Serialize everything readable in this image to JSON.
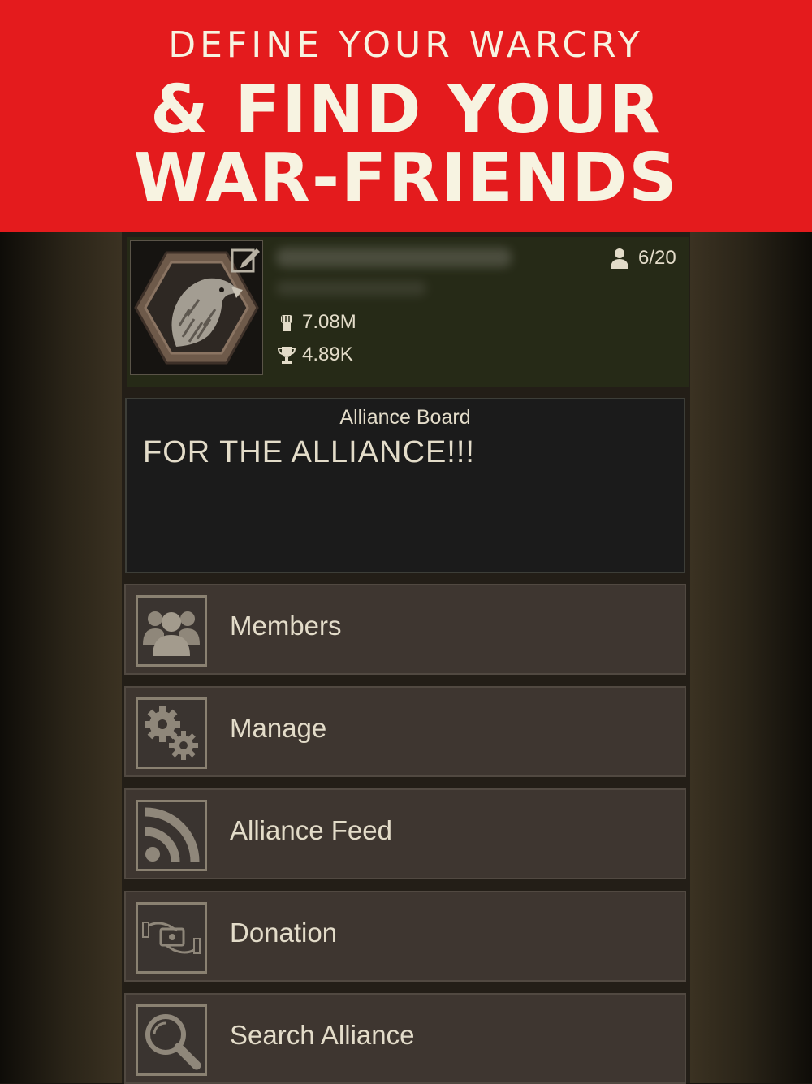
{
  "banner": {
    "line1": "DEFINE YOUR WARCRY",
    "line2": "& FIND YOUR",
    "line3": "WAR-FRIENDS"
  },
  "alliance": {
    "member_count": "6/20",
    "power": "7.08M",
    "trophies": "4.89K"
  },
  "board": {
    "title": "Alliance Board",
    "message": "FOR THE ALLIANCE!!!"
  },
  "menu": [
    {
      "label": "Members",
      "icon": "members-icon"
    },
    {
      "label": "Manage",
      "icon": "gears-icon"
    },
    {
      "label": "Alliance Feed",
      "icon": "rss-feed-icon"
    },
    {
      "label": "Donation",
      "icon": "donation-icon"
    },
    {
      "label": "Search Alliance",
      "icon": "search-icon"
    }
  ],
  "colors": {
    "banner_red": "#e41b1d",
    "banner_text": "#f7f3e1",
    "header_bg": "#262a17",
    "button_bg": "#3e3630",
    "text": "#e3dcc9"
  }
}
